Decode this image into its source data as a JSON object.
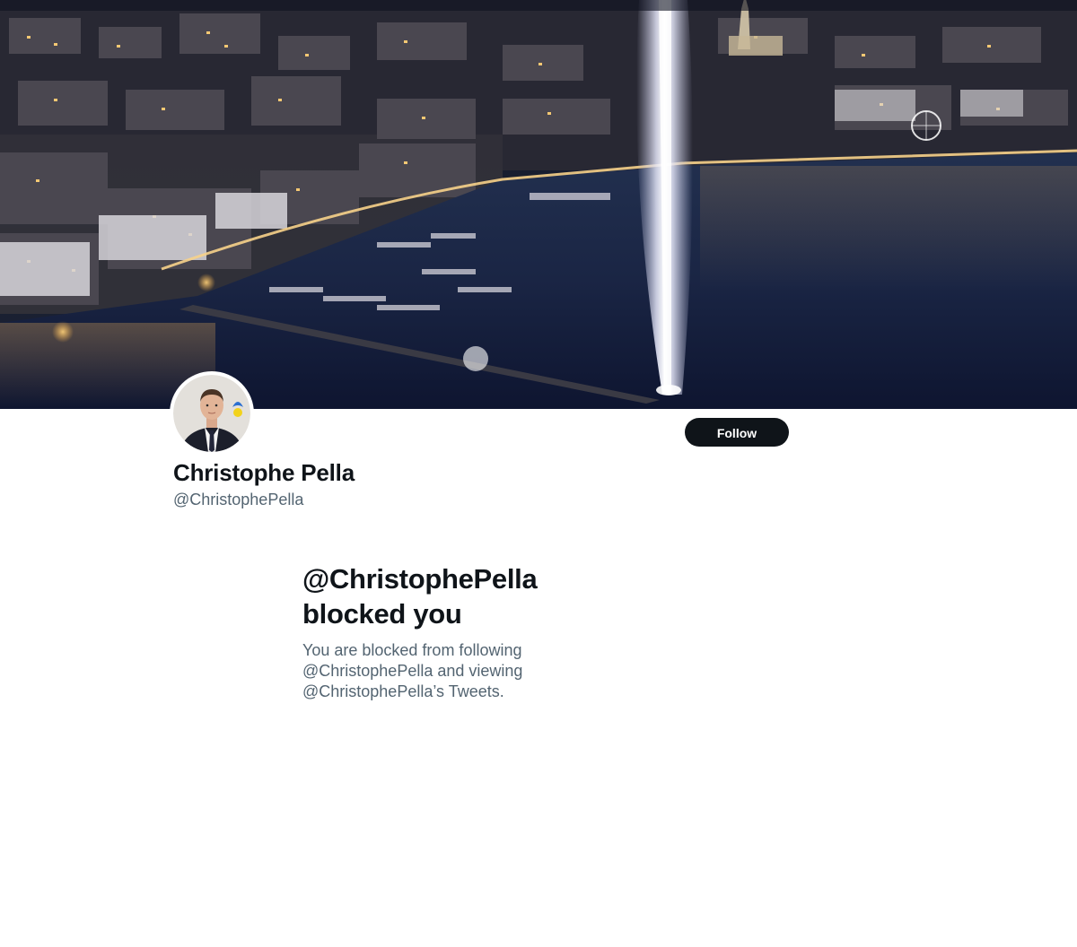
{
  "profile": {
    "display_name": "Christophe Pella",
    "handle": "@ChristophePella",
    "follow_label": "Follow"
  },
  "blocked_notice": {
    "title_line1": "@ChristophePella",
    "title_line2": "blocked you",
    "desc_line1": "You are blocked from following",
    "desc_line2": "@ChristophePella and viewing",
    "desc_line3": "@ChristophePella’s Tweets."
  },
  "colors": {
    "primary_text": "#0f1419",
    "secondary_text": "#536471",
    "button_bg": "#0f1419",
    "button_text": "#ffffff",
    "background": "#ffffff"
  },
  "icons": {
    "avatar": "profile-photo",
    "banner": "banner-image-night-city-lake-fountain"
  }
}
